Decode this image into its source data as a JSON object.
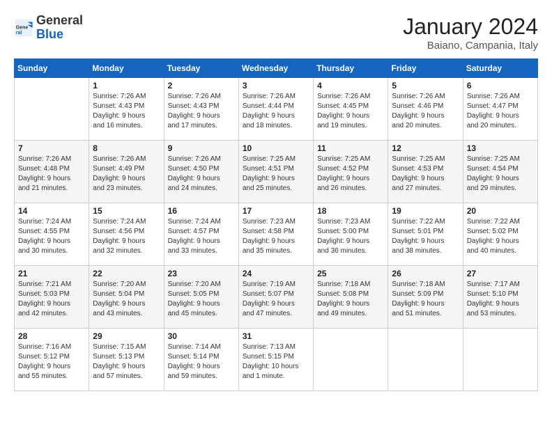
{
  "header": {
    "logo_general": "General",
    "logo_blue": "Blue",
    "month_title": "January 2024",
    "subtitle": "Baiano, Campania, Italy"
  },
  "days_of_week": [
    "Sunday",
    "Monday",
    "Tuesday",
    "Wednesday",
    "Thursday",
    "Friday",
    "Saturday"
  ],
  "weeks": [
    [
      {
        "day": "",
        "info": ""
      },
      {
        "day": "1",
        "info": "Sunrise: 7:26 AM\nSunset: 4:43 PM\nDaylight: 9 hours\nand 16 minutes."
      },
      {
        "day": "2",
        "info": "Sunrise: 7:26 AM\nSunset: 4:43 PM\nDaylight: 9 hours\nand 17 minutes."
      },
      {
        "day": "3",
        "info": "Sunrise: 7:26 AM\nSunset: 4:44 PM\nDaylight: 9 hours\nand 18 minutes."
      },
      {
        "day": "4",
        "info": "Sunrise: 7:26 AM\nSunset: 4:45 PM\nDaylight: 9 hours\nand 19 minutes."
      },
      {
        "day": "5",
        "info": "Sunrise: 7:26 AM\nSunset: 4:46 PM\nDaylight: 9 hours\nand 20 minutes."
      },
      {
        "day": "6",
        "info": "Sunrise: 7:26 AM\nSunset: 4:47 PM\nDaylight: 9 hours\nand 20 minutes."
      }
    ],
    [
      {
        "day": "7",
        "info": "Sunrise: 7:26 AM\nSunset: 4:48 PM\nDaylight: 9 hours\nand 21 minutes."
      },
      {
        "day": "8",
        "info": "Sunrise: 7:26 AM\nSunset: 4:49 PM\nDaylight: 9 hours\nand 23 minutes."
      },
      {
        "day": "9",
        "info": "Sunrise: 7:26 AM\nSunset: 4:50 PM\nDaylight: 9 hours\nand 24 minutes."
      },
      {
        "day": "10",
        "info": "Sunrise: 7:25 AM\nSunset: 4:51 PM\nDaylight: 9 hours\nand 25 minutes."
      },
      {
        "day": "11",
        "info": "Sunrise: 7:25 AM\nSunset: 4:52 PM\nDaylight: 9 hours\nand 26 minutes."
      },
      {
        "day": "12",
        "info": "Sunrise: 7:25 AM\nSunset: 4:53 PM\nDaylight: 9 hours\nand 27 minutes."
      },
      {
        "day": "13",
        "info": "Sunrise: 7:25 AM\nSunset: 4:54 PM\nDaylight: 9 hours\nand 29 minutes."
      }
    ],
    [
      {
        "day": "14",
        "info": "Sunrise: 7:24 AM\nSunset: 4:55 PM\nDaylight: 9 hours\nand 30 minutes."
      },
      {
        "day": "15",
        "info": "Sunrise: 7:24 AM\nSunset: 4:56 PM\nDaylight: 9 hours\nand 32 minutes."
      },
      {
        "day": "16",
        "info": "Sunrise: 7:24 AM\nSunset: 4:57 PM\nDaylight: 9 hours\nand 33 minutes."
      },
      {
        "day": "17",
        "info": "Sunrise: 7:23 AM\nSunset: 4:58 PM\nDaylight: 9 hours\nand 35 minutes."
      },
      {
        "day": "18",
        "info": "Sunrise: 7:23 AM\nSunset: 5:00 PM\nDaylight: 9 hours\nand 36 minutes."
      },
      {
        "day": "19",
        "info": "Sunrise: 7:22 AM\nSunset: 5:01 PM\nDaylight: 9 hours\nand 38 minutes."
      },
      {
        "day": "20",
        "info": "Sunrise: 7:22 AM\nSunset: 5:02 PM\nDaylight: 9 hours\nand 40 minutes."
      }
    ],
    [
      {
        "day": "21",
        "info": "Sunrise: 7:21 AM\nSunset: 5:03 PM\nDaylight: 9 hours\nand 42 minutes."
      },
      {
        "day": "22",
        "info": "Sunrise: 7:20 AM\nSunset: 5:04 PM\nDaylight: 9 hours\nand 43 minutes."
      },
      {
        "day": "23",
        "info": "Sunrise: 7:20 AM\nSunset: 5:05 PM\nDaylight: 9 hours\nand 45 minutes."
      },
      {
        "day": "24",
        "info": "Sunrise: 7:19 AM\nSunset: 5:07 PM\nDaylight: 9 hours\nand 47 minutes."
      },
      {
        "day": "25",
        "info": "Sunrise: 7:18 AM\nSunset: 5:08 PM\nDaylight: 9 hours\nand 49 minutes."
      },
      {
        "day": "26",
        "info": "Sunrise: 7:18 AM\nSunset: 5:09 PM\nDaylight: 9 hours\nand 51 minutes."
      },
      {
        "day": "27",
        "info": "Sunrise: 7:17 AM\nSunset: 5:10 PM\nDaylight: 9 hours\nand 53 minutes."
      }
    ],
    [
      {
        "day": "28",
        "info": "Sunrise: 7:16 AM\nSunset: 5:12 PM\nDaylight: 9 hours\nand 55 minutes."
      },
      {
        "day": "29",
        "info": "Sunrise: 7:15 AM\nSunset: 5:13 PM\nDaylight: 9 hours\nand 57 minutes."
      },
      {
        "day": "30",
        "info": "Sunrise: 7:14 AM\nSunset: 5:14 PM\nDaylight: 9 hours\nand 59 minutes."
      },
      {
        "day": "31",
        "info": "Sunrise: 7:13 AM\nSunset: 5:15 PM\nDaylight: 10 hours\nand 1 minute."
      },
      {
        "day": "",
        "info": ""
      },
      {
        "day": "",
        "info": ""
      },
      {
        "day": "",
        "info": ""
      }
    ]
  ]
}
